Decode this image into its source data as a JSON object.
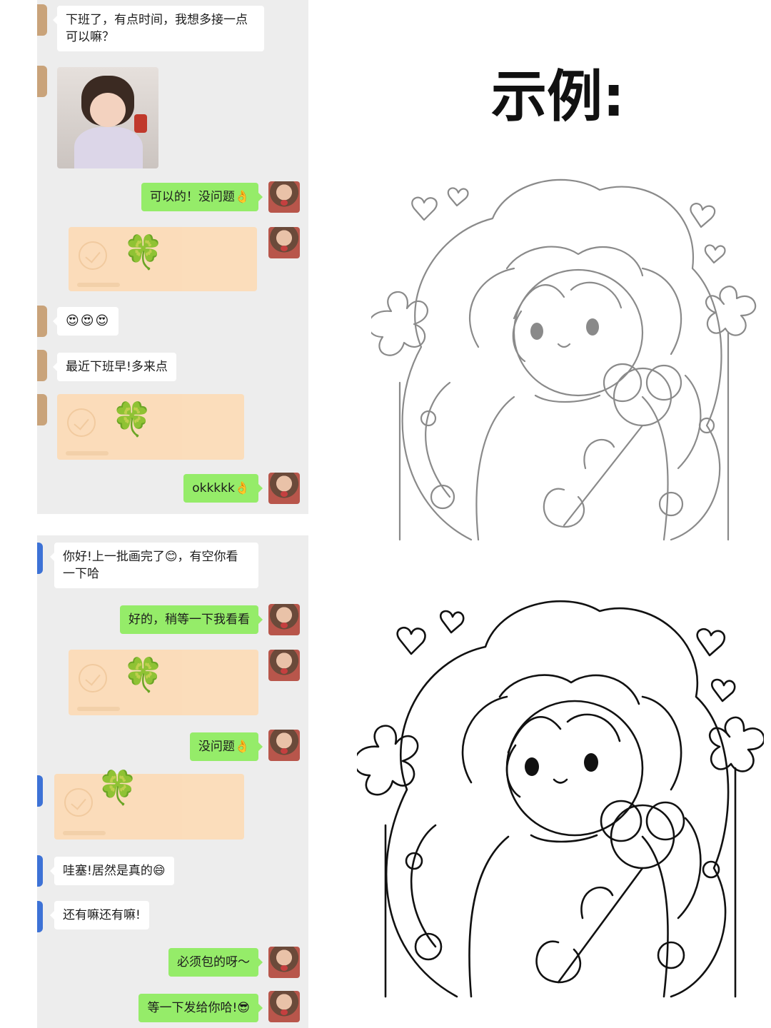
{
  "top_chat": {
    "msg1": "下班了，有点时间，我想多接一点可以嘛？",
    "msg2": "可以的！没问题👌",
    "msg3": "😍😍😍",
    "msg4": "最近下班早!多来点",
    "msg5": "okkkkk👌",
    "transfer_icon": "four-leaf-clover"
  },
  "bottom_chat": {
    "msg1": "你好!上一批画完了😊，有空你看一下哈",
    "msg2": "好的，稍等一下我看看",
    "msg3": "没问题👌",
    "msg4": "哇塞!居然是真的😄",
    "msg5": "还有嘛还有嘛!",
    "msg6": "必须包的呀～",
    "msg7": "等一下发给你哈!😎",
    "transfer_icon": "four-leaf-clover"
  },
  "example": {
    "title": "示例:"
  },
  "colors": {
    "chat_bg": "#ededed",
    "sent_bubble": "#95ec69",
    "received_bubble": "#ffffff",
    "transfer_card": "#fcdcb8",
    "gray_line_art": "#8a8a8a",
    "black_line_art": "#111111"
  }
}
